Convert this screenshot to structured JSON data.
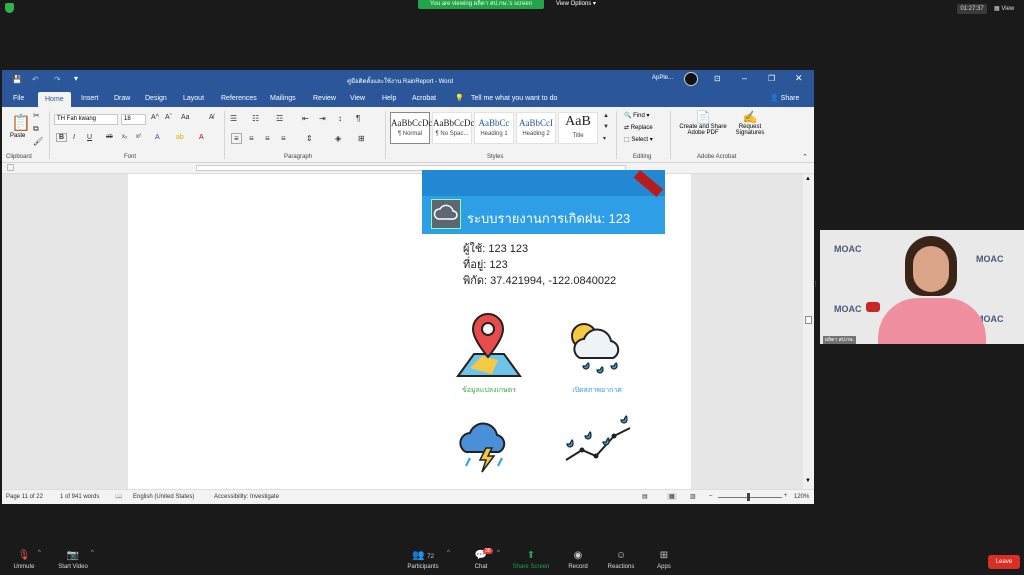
{
  "zoom_top": {
    "banner": "You are viewing ผลิตา สป.กษ.'s screen",
    "view_options": "View Options",
    "clock": "01:27:37",
    "view": "View"
  },
  "word": {
    "title": "คู่มือติดตั้งและใช้งาน RainReport - Word",
    "user": "ApPle...",
    "share": "Share",
    "tabs": [
      "File",
      "Home",
      "Insert",
      "Draw",
      "Design",
      "Layout",
      "References",
      "Mailings",
      "Review",
      "View",
      "Help",
      "Acrobat"
    ],
    "tell_me": "Tell me what you want to do",
    "ribbon": {
      "paste": "Paste",
      "font_name": "TH Fah kwang",
      "font_size": "18",
      "groups": {
        "clipboard": "Clipboard",
        "font": "Font",
        "paragraph": "Paragraph",
        "styles": "Styles",
        "editing": "Editing",
        "adobe": "Adobe Acrobat"
      },
      "styles": [
        {
          "preview": "AaBbCcDc",
          "name": "¶ Normal"
        },
        {
          "preview": "AaBbCcDc",
          "name": "¶ No Spac..."
        },
        {
          "preview": "AaBbCc",
          "name": "Heading 1"
        },
        {
          "preview": "AaBbCcI",
          "name": "Heading 2"
        },
        {
          "preview": "AaB",
          "name": "Title"
        }
      ],
      "find": "Find",
      "replace": "Replace",
      "select": "Select",
      "create_share_pdf_1": "Create and Share",
      "create_share_pdf_2": "Adobe PDF",
      "request_sig_1": "Request",
      "request_sig_2": "Signatures"
    },
    "status": {
      "page": "Page 11 of 22",
      "words": "1 of 941 words",
      "language": "English (United States)",
      "accessibility": "Accessibility: Investigate",
      "zoom": "120%"
    }
  },
  "app": {
    "title": "ระบบรายงานการเกิดฝน: 123",
    "user_line": "ผู้ใช้: 123 123",
    "address_line": "ที่อยู่: 123",
    "coords_line": "พิกัด: 37.421994, -122.0840022",
    "label_farm": "ข้อมูลแปลงเกษตร",
    "label_weather": "เปิดสภาพอากาศ"
  },
  "participant": {
    "watermark": "MOAC",
    "name_tag": "ผลิตา สป.กษ."
  },
  "zoom_bottom": {
    "unmute": "Unmute",
    "start_video": "Start Video",
    "participants": "Participants",
    "participants_count": "72",
    "chat": "Chat",
    "chat_badge": "38",
    "share_screen": "Share Screen",
    "record": "Record",
    "reactions": "Reactions",
    "apps": "Apps",
    "leave": "Leave"
  },
  "colors": {
    "word_blue": "#2b579a",
    "app_blue": "#2e9ee6",
    "leave_red": "#d93025",
    "share_green": "#23a34a",
    "label_green": "#3fa64c",
    "label_blue": "#2e9ee6"
  }
}
